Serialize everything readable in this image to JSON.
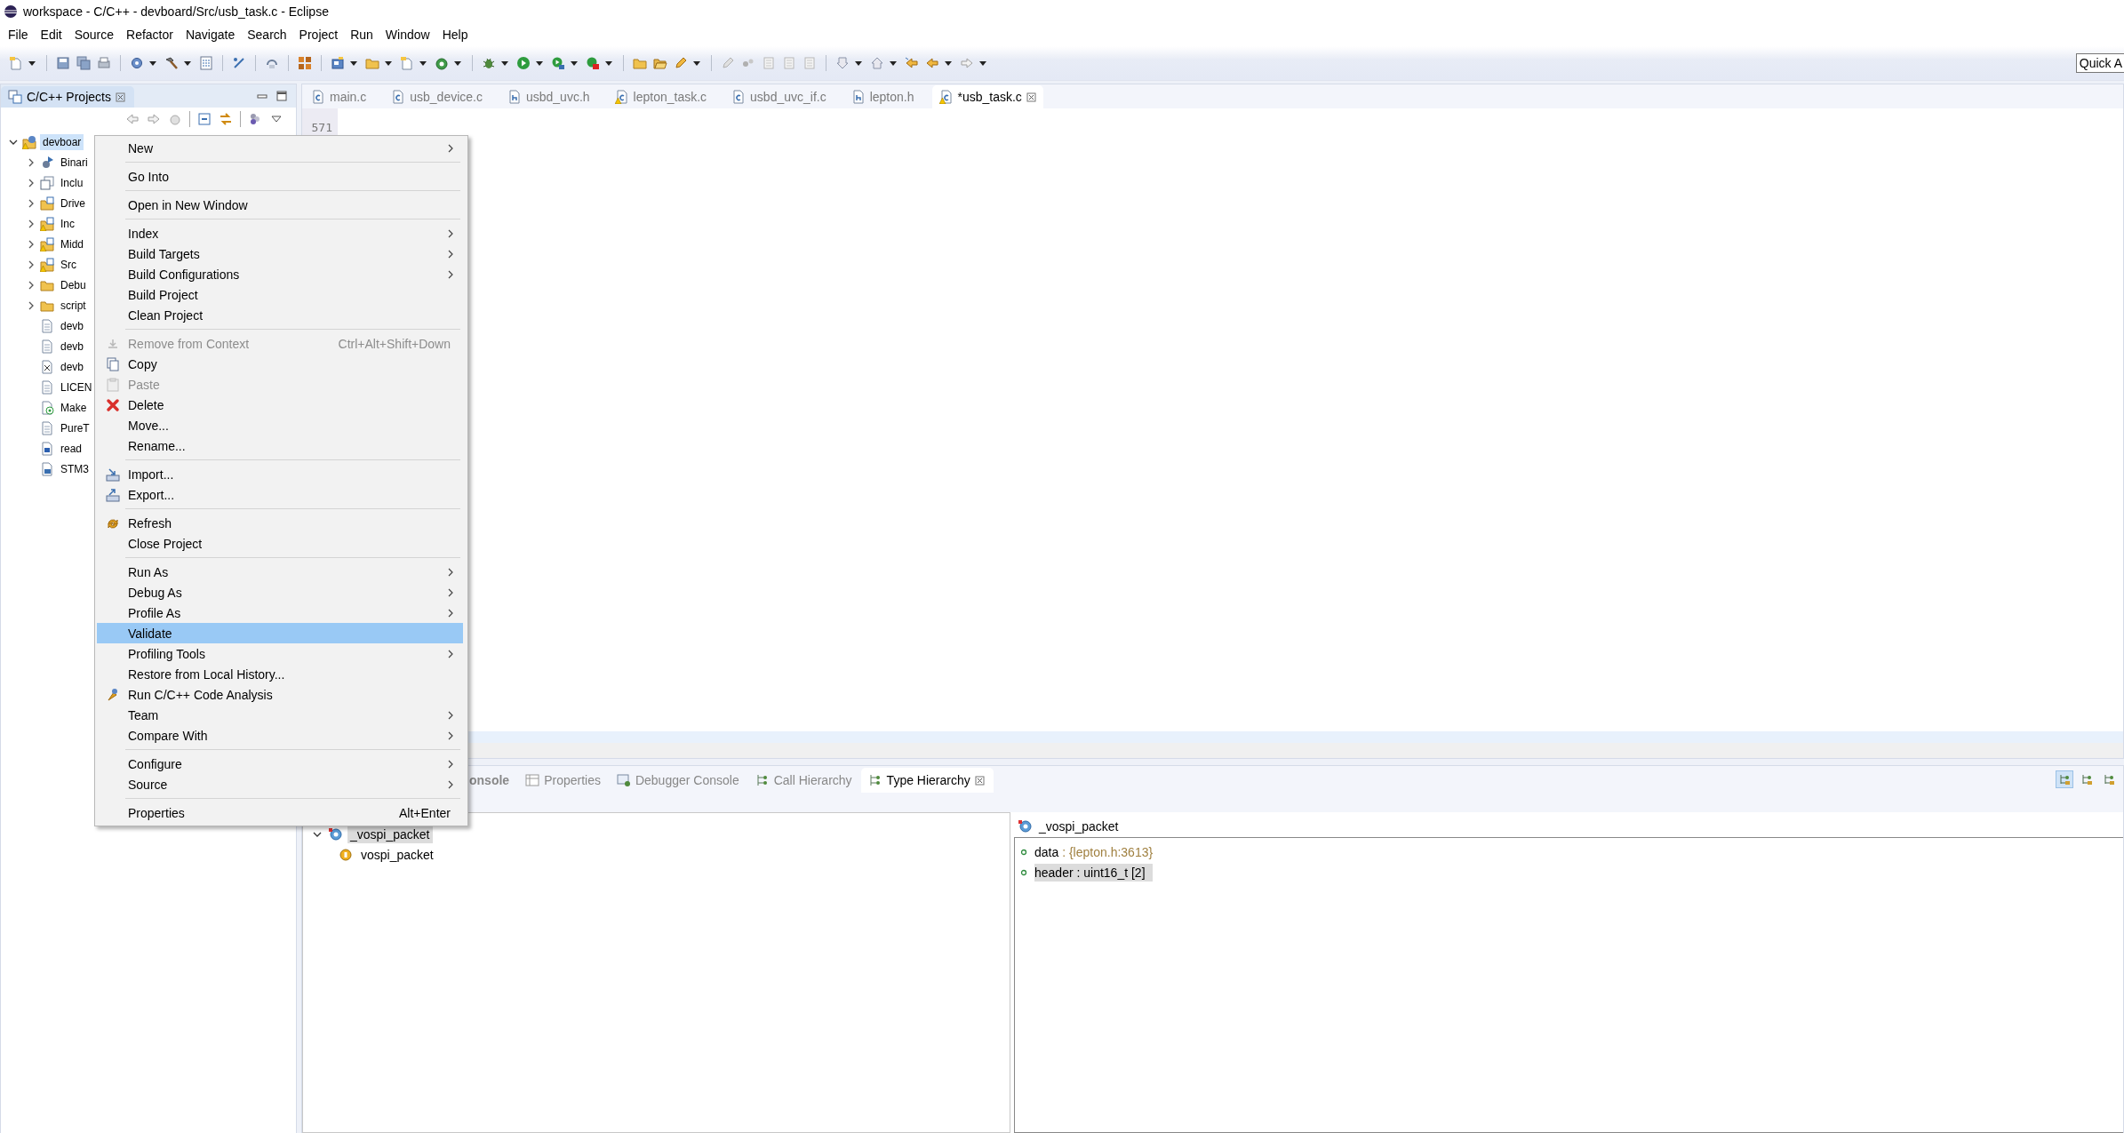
{
  "window": {
    "title": "workspace - C/C++ - devboard/Src/usb_task.c - Eclipse"
  },
  "menu_bar": [
    "File",
    "Edit",
    "Source",
    "Refactor",
    "Navigate",
    "Search",
    "Project",
    "Run",
    "Window",
    "Help"
  ],
  "quick_access": {
    "placeholder": "Quick A"
  },
  "project_explorer": {
    "title": "C/C++ Projects",
    "tree": [
      {
        "label": "devboar",
        "kind": "project",
        "warning": true,
        "expanded": true,
        "selected": true,
        "children": [
          {
            "label": "Binari",
            "kind": "binaries",
            "warning": false,
            "expanded": false,
            "selected": false
          },
          {
            "label": "Inclu",
            "kind": "includes",
            "warning": false,
            "expanded": false,
            "selected": false
          },
          {
            "label": "Drive",
            "kind": "source-folder",
            "warning": false,
            "expanded": false,
            "selected": false
          },
          {
            "label": "Inc",
            "kind": "source-folder",
            "warning": true,
            "expanded": false,
            "selected": false
          },
          {
            "label": "Midd",
            "kind": "source-folder",
            "warning": true,
            "expanded": false,
            "selected": false
          },
          {
            "label": "Src",
            "kind": "source-folder",
            "warning": true,
            "expanded": false,
            "selected": false
          },
          {
            "label": "Debu",
            "kind": "folder",
            "warning": false,
            "expanded": false,
            "selected": false
          },
          {
            "label": "script",
            "kind": "folder",
            "warning": false,
            "expanded": false,
            "selected": false
          },
          {
            "label": "devb",
            "kind": "file",
            "warning": false,
            "selected": false
          },
          {
            "label": "devb",
            "kind": "file",
            "warning": false,
            "selected": false
          },
          {
            "label": "devb",
            "kind": "xml",
            "warning": false,
            "selected": false
          },
          {
            "label": "LICEN",
            "kind": "file",
            "warning": false,
            "selected": false
          },
          {
            "label": "Make",
            "kind": "make",
            "warning": false,
            "selected": false
          },
          {
            "label": "PureT",
            "kind": "file",
            "warning": false,
            "selected": false
          },
          {
            "label": "read",
            "kind": "doc",
            "warning": false,
            "selected": false
          },
          {
            "label": "STM3",
            "kind": "linker",
            "warning": false,
            "selected": false
          }
        ]
      }
    ]
  },
  "editor": {
    "tabs": [
      {
        "label": "main.c",
        "kind": "c",
        "warning": false,
        "selected": false
      },
      {
        "label": "usb_device.c",
        "kind": "c",
        "warning": false,
        "selected": false
      },
      {
        "label": "usbd_uvc.h",
        "kind": "h",
        "warning": false,
        "selected": false
      },
      {
        "label": "lepton_task.c",
        "kind": "c",
        "warning": true,
        "selected": false
      },
      {
        "label": "usbd_uvc_if.c",
        "kind": "c",
        "warning": false,
        "selected": false
      },
      {
        "label": "lepton.h",
        "kind": "h",
        "warning": false,
        "selected": false
      },
      {
        "label": "*usb_task.c",
        "kind": "c",
        "warning": true,
        "selected": true
      }
    ],
    "line_numbers": [
      "571"
    ]
  },
  "context_menu": {
    "groups": [
      [
        {
          "label": "New",
          "submenu": true,
          "disabled": false,
          "selected": false
        }
      ],
      [
        {
          "label": "Go Into",
          "submenu": false,
          "disabled": false,
          "selected": false
        }
      ],
      [
        {
          "label": "Open in New Window",
          "submenu": false,
          "disabled": false,
          "selected": false
        }
      ],
      [
        {
          "label": "Index",
          "submenu": true,
          "disabled": false,
          "selected": false
        },
        {
          "label": "Build Targets",
          "submenu": true,
          "disabled": false,
          "selected": false
        },
        {
          "label": "Build Configurations",
          "submenu": true,
          "disabled": false,
          "selected": false
        },
        {
          "label": "Build Project",
          "submenu": false,
          "disabled": false,
          "selected": false
        },
        {
          "label": "Clean Project",
          "submenu": false,
          "disabled": false,
          "selected": false
        }
      ],
      [
        {
          "label": "Remove from Context",
          "shortcut": "Ctrl+Alt+Shift+Down",
          "submenu": false,
          "disabled": true,
          "selected": false
        },
        {
          "label": "Copy",
          "submenu": false,
          "disabled": false,
          "selected": false
        },
        {
          "label": "Paste",
          "submenu": false,
          "disabled": true,
          "selected": false
        },
        {
          "label": "Delete",
          "submenu": false,
          "disabled": false,
          "selected": false
        },
        {
          "label": "Move...",
          "submenu": false,
          "disabled": false,
          "selected": false
        },
        {
          "label": "Rename...",
          "submenu": false,
          "disabled": false,
          "selected": false
        }
      ],
      [
        {
          "label": "Import...",
          "submenu": false,
          "disabled": false,
          "selected": false
        },
        {
          "label": "Export...",
          "submenu": false,
          "disabled": false,
          "selected": false
        }
      ],
      [
        {
          "label": "Refresh",
          "submenu": false,
          "disabled": false,
          "selected": false
        },
        {
          "label": "Close Project",
          "submenu": false,
          "disabled": false,
          "selected": false
        }
      ],
      [
        {
          "label": "Run As",
          "submenu": true,
          "disabled": false,
          "selected": false
        },
        {
          "label": "Debug As",
          "submenu": true,
          "disabled": false,
          "selected": false
        },
        {
          "label": "Profile As",
          "submenu": true,
          "disabled": false,
          "selected": false
        },
        {
          "label": "Validate",
          "submenu": false,
          "disabled": false,
          "selected": true
        },
        {
          "label": "Profiling Tools",
          "submenu": true,
          "disabled": false,
          "selected": false
        },
        {
          "label": "Restore from Local History...",
          "submenu": false,
          "disabled": false,
          "selected": false
        },
        {
          "label": "Run C/C++ Code Analysis",
          "submenu": false,
          "disabled": false,
          "selected": false
        },
        {
          "label": "Team",
          "submenu": true,
          "disabled": false,
          "selected": false
        },
        {
          "label": "Compare With",
          "submenu": true,
          "disabled": false,
          "selected": false
        }
      ],
      [
        {
          "label": "Configure",
          "submenu": true,
          "disabled": false,
          "selected": false
        },
        {
          "label": "Source",
          "submenu": true,
          "disabled": false,
          "selected": false
        }
      ],
      [
        {
          "label": "Properties",
          "shortcut": "Alt+Enter",
          "submenu": false,
          "disabled": false,
          "selected": false
        }
      ]
    ]
  },
  "bottom_panel": {
    "tabs": [
      {
        "label": "onsole",
        "highlighted": true,
        "selected": false
      },
      {
        "label": "Properties",
        "highlighted": false,
        "selected": false
      },
      {
        "label": "Debugger Console",
        "highlighted": false,
        "selected": false
      },
      {
        "label": "Call Hierarchy",
        "highlighted": false,
        "selected": false
      },
      {
        "label": "Type Hierarchy",
        "highlighted": false,
        "selected": true
      }
    ],
    "view_modes": [
      {
        "selected": true
      },
      {
        "selected": false
      },
      {
        "selected": false
      }
    ],
    "hierarchy_tree": [
      {
        "label": "_vospi_packet",
        "kind": "struct",
        "expanded": true,
        "selected": true,
        "children": [
          {
            "label": "vospi_packet",
            "kind": "typedef",
            "selected": false
          }
        ]
      }
    ],
    "members": {
      "title": "_vospi_packet",
      "items": [
        {
          "name": "data",
          "detail": ": {lepton.h:3613}",
          "kind": "location",
          "selected": false
        },
        {
          "name": "header",
          "detail": ": uint16_t [2]",
          "kind": "type",
          "selected": true
        }
      ]
    }
  }
}
